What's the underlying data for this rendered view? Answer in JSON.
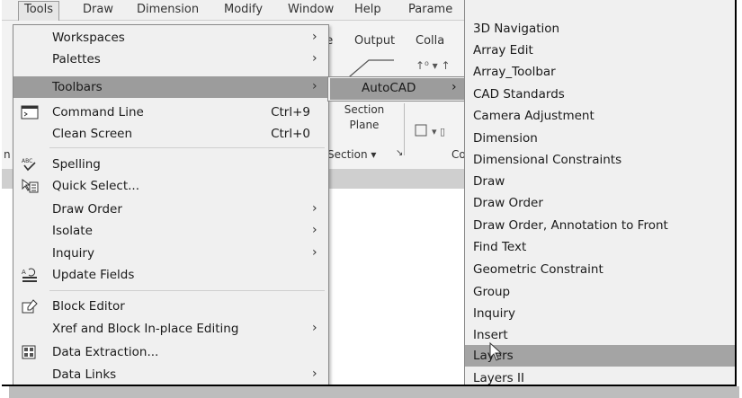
{
  "menubar": {
    "items": [
      "Tools",
      "Draw",
      "Dimension",
      "Modify",
      "Window",
      "Help",
      "Parame"
    ]
  },
  "ribbon": {
    "tab_fragments": [
      "ge",
      "Output",
      "Colla"
    ],
    "section_plane": [
      "Section",
      "Plane"
    ],
    "section_label": "Section ▾",
    "co_fragment": "Co",
    "left_fragment": "n"
  },
  "tools_menu": {
    "items": [
      {
        "label": "Workspaces",
        "submenu": true
      },
      {
        "label": "Palettes",
        "submenu": true
      },
      {
        "label": "Toolbars",
        "submenu": true,
        "highlighted": true
      },
      {
        "label": "Command Line",
        "shortcut": "Ctrl+9",
        "icon": "command-line-icon"
      },
      {
        "label": "Clean Screen",
        "shortcut": "Ctrl+0"
      },
      {
        "label": "Spelling",
        "icon": "spelling-icon"
      },
      {
        "label": "Quick Select...",
        "icon": "quick-select-icon"
      },
      {
        "label": "Draw Order",
        "submenu": true
      },
      {
        "label": "Isolate",
        "submenu": true
      },
      {
        "label": "Inquiry",
        "submenu": true
      },
      {
        "label": "Update Fields",
        "icon": "update-fields-icon"
      },
      {
        "label": "Block Editor",
        "icon": "block-editor-icon"
      },
      {
        "label": "Xref and Block In-place Editing",
        "submenu": true
      },
      {
        "label": "Data Extraction...",
        "icon": "data-extraction-icon"
      },
      {
        "label": "Data Links",
        "submenu": true
      }
    ]
  },
  "toolbars_submenu": {
    "label": "AutoCAD"
  },
  "autocad_submenu": {
    "items": [
      "3D Navigation",
      "Array Edit",
      "Array_Toolbar",
      "CAD Standards",
      "Camera Adjustment",
      "Dimension",
      "Dimensional Constraints",
      "Draw",
      "Draw Order",
      "Draw Order, Annotation to Front",
      "Find Text",
      "Geometric Constraint",
      "Group",
      "Inquiry",
      "Insert",
      "Layers",
      "Layers II"
    ],
    "highlighted": "Layers"
  },
  "colors": {
    "menu_bg": "#f0f0f0",
    "highlight": "#9c9c9c"
  }
}
